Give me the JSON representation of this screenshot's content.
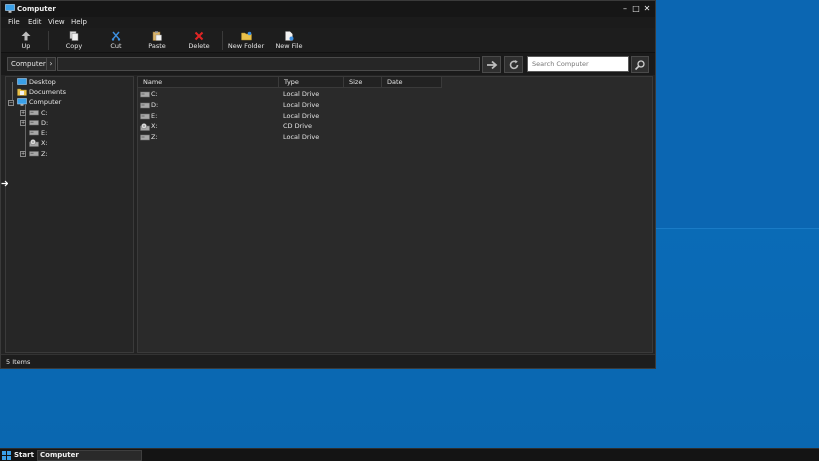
{
  "window": {
    "title": "Computer",
    "icon": "computer-icon",
    "controls": [
      "minimize",
      "maximize",
      "close"
    ]
  },
  "menu": [
    "File",
    "Edit",
    "View",
    "Help"
  ],
  "toolbar": {
    "up": "Up",
    "copy": "Copy",
    "cut": "Cut",
    "paste": "Paste",
    "delete": "Delete",
    "new_folder": "New Folder",
    "new_file": "New File"
  },
  "address": {
    "crumb": "Computer",
    "search_placeholder": "Search Computer"
  },
  "tree": {
    "desktop": "Desktop",
    "documents": "Documents",
    "computer": "Computer",
    "drives": [
      "C:",
      "D:",
      "E:",
      "X:",
      "Z:"
    ]
  },
  "list": {
    "columns": [
      "Name",
      "Type",
      "Size",
      "Date"
    ],
    "rows": [
      {
        "name": "C:",
        "type": "Local Drive",
        "icon": "hard-drive-icon"
      },
      {
        "name": "D:",
        "type": "Local Drive",
        "icon": "hard-drive-icon"
      },
      {
        "name": "E:",
        "type": "Local Drive",
        "icon": "hard-drive-icon"
      },
      {
        "name": "X:",
        "type": "CD Drive",
        "icon": "cd-drive-icon"
      },
      {
        "name": "Z:",
        "type": "Local Drive",
        "icon": "hard-drive-icon"
      }
    ]
  },
  "status": "5 Items",
  "taskbar": {
    "start": "Start",
    "task": "Computer"
  },
  "colors": {
    "desktop": "#0b6bb6",
    "window_bg": "#232323",
    "delete_icon": "#e02424",
    "folder_icon": "#e8c04a"
  }
}
